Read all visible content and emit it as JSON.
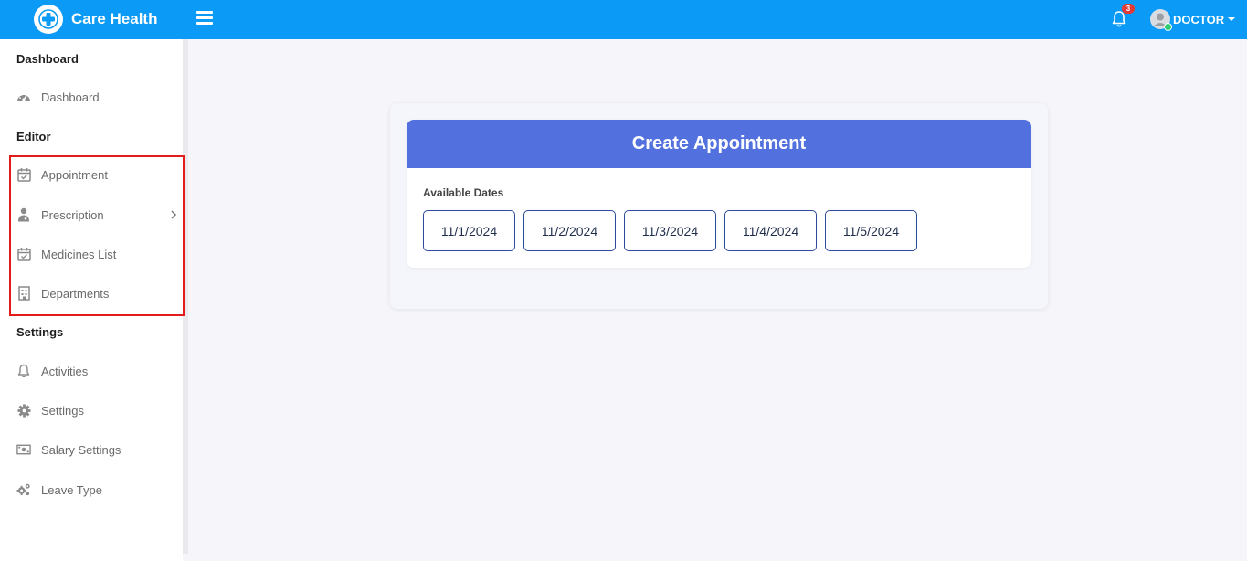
{
  "app": {
    "brand_name": "Care Health",
    "logo_icon": "medical-cross-icon"
  },
  "topbar": {
    "background": "#0b9af5",
    "notification_count": "3",
    "user_label": "DOCTOR",
    "user_status": "online"
  },
  "sidebar": {
    "sections": [
      {
        "title": "Dashboard",
        "items": [
          {
            "label": "Dashboard",
            "icon": "speedometer-icon"
          }
        ]
      },
      {
        "title": "Editor",
        "items": [
          {
            "label": "Appointment",
            "icon": "calendar-check-icon"
          },
          {
            "label": "Prescription",
            "icon": "doctor-icon",
            "has_submenu": true
          },
          {
            "label": "Medicines List",
            "icon": "calendar-check-icon"
          },
          {
            "label": "Departments",
            "icon": "hospital-building-icon"
          }
        ]
      },
      {
        "title": "Settings",
        "items": [
          {
            "label": "Activities",
            "icon": "bell-icon"
          },
          {
            "label": "Settings",
            "icon": "gear-icon"
          },
          {
            "label": "Salary Settings",
            "icon": "money-bill-icon"
          },
          {
            "label": "Leave Type",
            "icon": "gears-icon"
          }
        ]
      }
    ],
    "highlight_color": "#e31b1b"
  },
  "main": {
    "card_title": "Create Appointment",
    "header_color": "#5271de",
    "available_dates_label": "Available Dates",
    "dates": [
      "11/1/2024",
      "11/2/2024",
      "11/3/2024",
      "11/4/2024",
      "11/5/2024"
    ]
  }
}
